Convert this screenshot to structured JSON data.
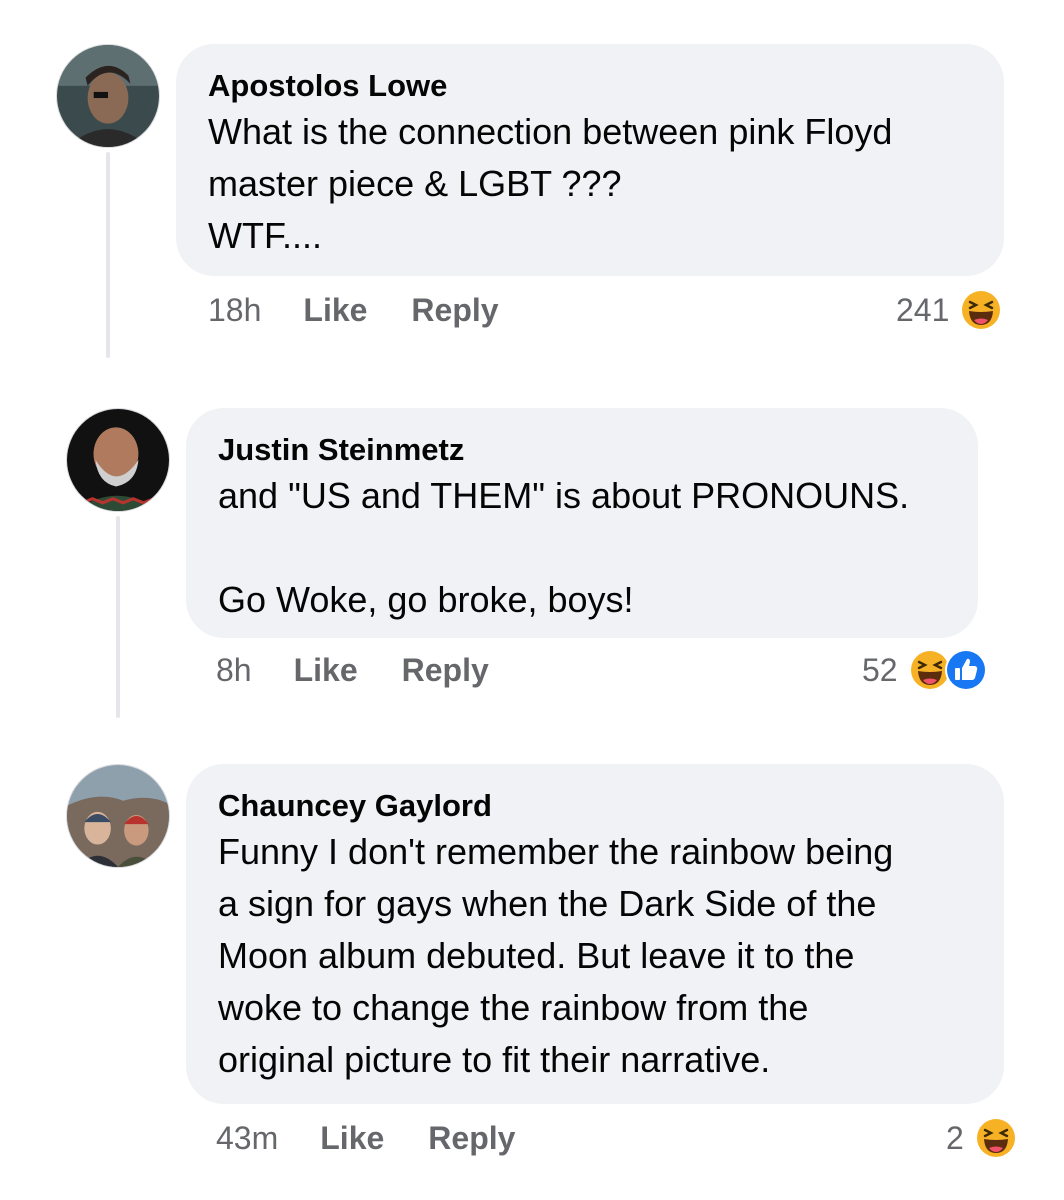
{
  "comments": [
    {
      "author": "Apostolos Lowe",
      "text": "What is the connection between pink Floyd\nmaster piece & LGBT ???\nWTF....",
      "time": "18h",
      "like_label": "Like",
      "reply_label": "Reply",
      "reaction_count": "241",
      "reactions": [
        "haha-icon"
      ]
    },
    {
      "author": "Justin Steinmetz",
      "text": "and \"US and THEM\" is about PRONOUNS.\n\nGo Woke, go broke, boys!",
      "time": "8h",
      "like_label": "Like",
      "reply_label": "Reply",
      "reaction_count": "52",
      "reactions": [
        "haha-icon",
        "like-icon"
      ]
    },
    {
      "author": "Chauncey Gaylord",
      "text": "Funny I don't remember the rainbow being\na sign for gays when the Dark Side of the\nMoon album debuted. But leave it to the\nwoke to change the rainbow from the\noriginal picture to fit their narrative.",
      "time": "43m",
      "like_label": "Like",
      "reply_label": "Reply",
      "reaction_count": "2",
      "reactions": [
        "haha-icon"
      ]
    }
  ],
  "colors": {
    "bubble": "#f0f2f5",
    "meta": "#65676b",
    "haha": "#f7b125",
    "like": "#1877f2"
  }
}
